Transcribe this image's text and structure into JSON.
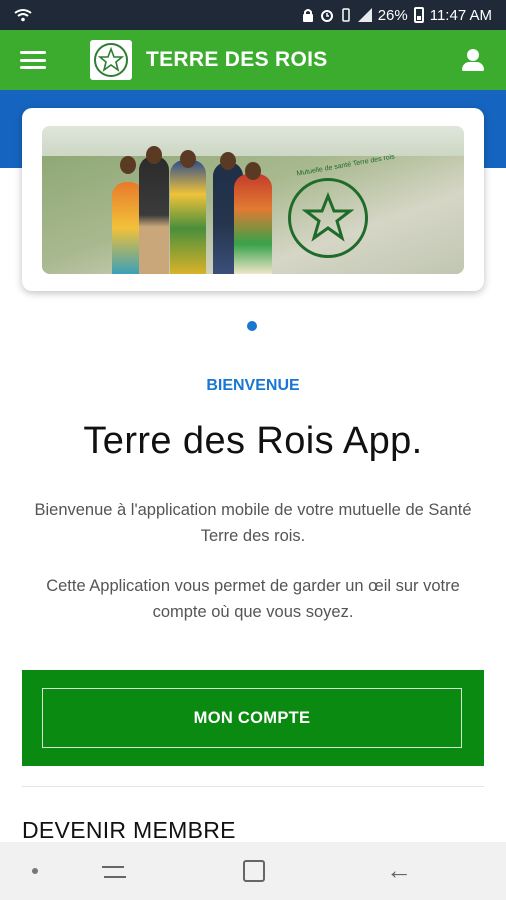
{
  "status_bar": {
    "battery_percent": "26%",
    "time": "11:47 AM"
  },
  "app_bar": {
    "title": "TERRE DES ROIS",
    "menu_icon": "menu-icon",
    "profile_icon": "user-icon"
  },
  "carousel": {
    "emblem_text": "Mutuelle de santé Terre des rois",
    "active_index": 1,
    "total": 1
  },
  "welcome": {
    "label": "BIENVENUE",
    "title": "Terre des Rois App.",
    "paragraph1": "Bienvenue à l'application mobile de votre mutuelle de Santé Terre des rois.",
    "paragraph2": "Cette Application vous permet de garder un œil sur votre compte où que vous soyez."
  },
  "account": {
    "button_label": "MON COMPTE"
  },
  "sections": {
    "become_member": "DEVENIR MEMBRE"
  },
  "colors": {
    "app_bar": "#3cac2f",
    "blue_band": "#1565c0",
    "accent_blue": "#1976d2",
    "account_green": "#0a8a10"
  }
}
